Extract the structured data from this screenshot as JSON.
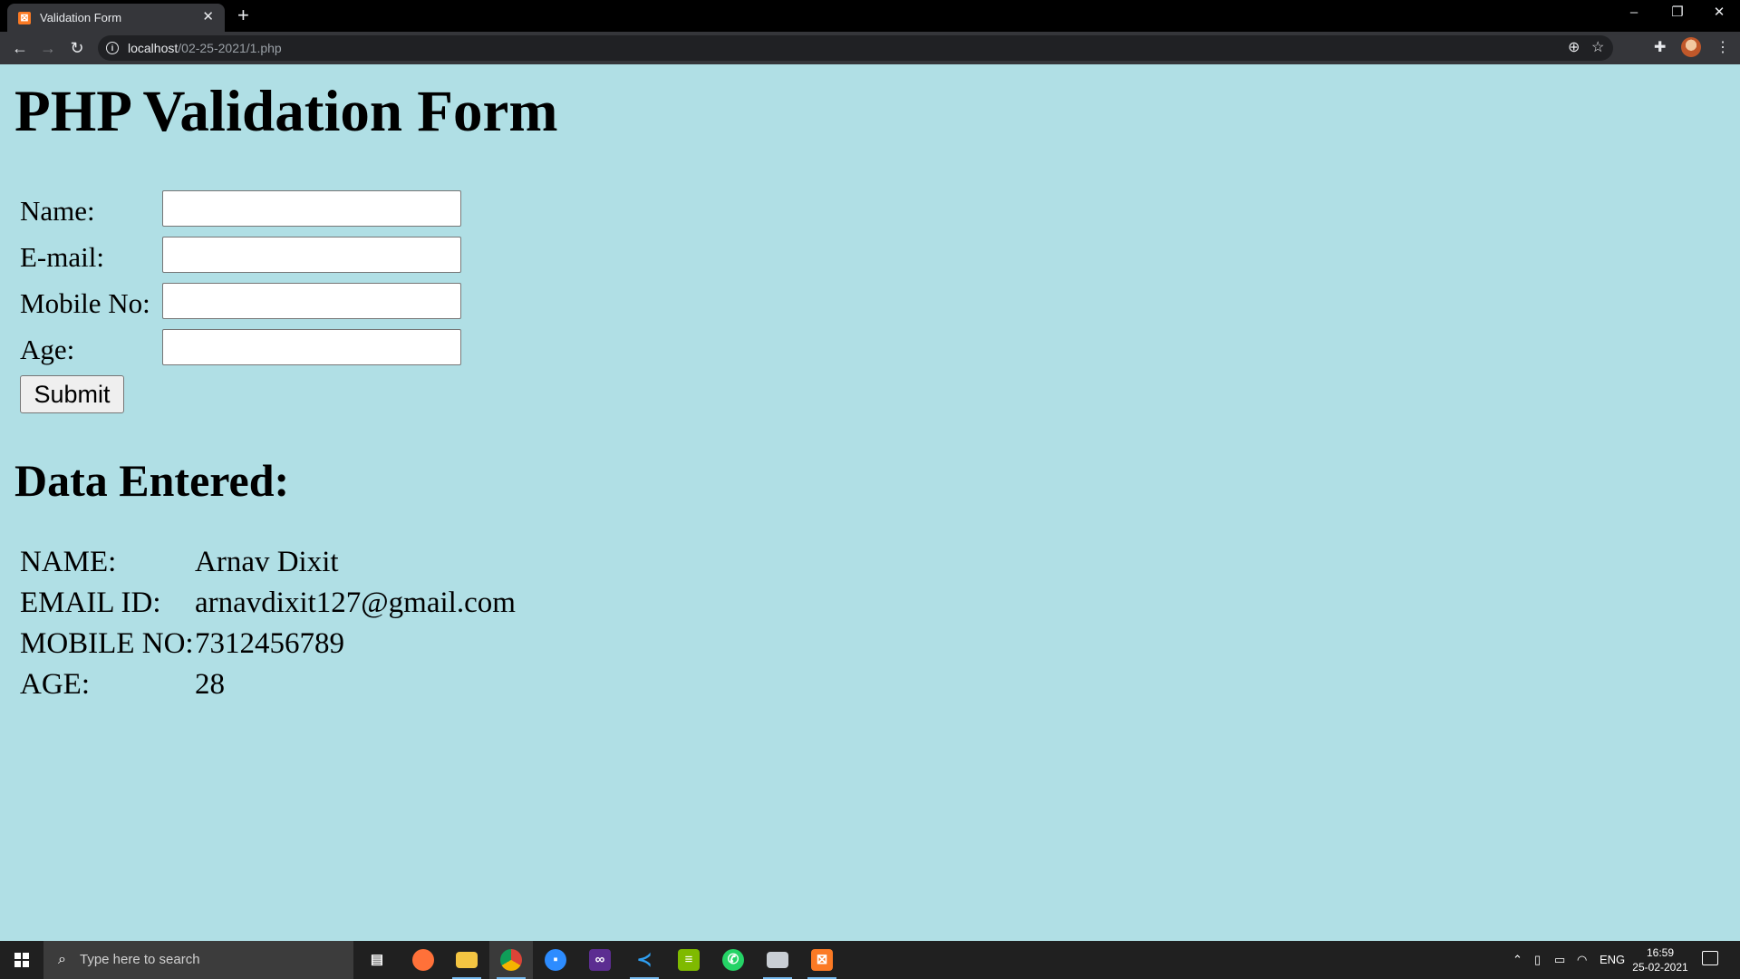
{
  "browser": {
    "tab_title": "Validation Form",
    "url_host": "localhost",
    "url_path": "/02-25-2021/1.php"
  },
  "page": {
    "title": "PHP Validation Form",
    "form": {
      "fields": [
        {
          "label": "Name:",
          "value": ""
        },
        {
          "label": "E-mail:",
          "value": ""
        },
        {
          "label": "Mobile No:",
          "value": ""
        },
        {
          "label": "Age:",
          "value": ""
        }
      ],
      "submit_label": "Submit"
    },
    "result": {
      "heading": "Data Entered:",
      "rows": [
        {
          "key": "NAME:",
          "value": "Arnav Dixit"
        },
        {
          "key": "EMAIL ID:",
          "value": "arnavdixit127@gmail.com"
        },
        {
          "key": "MOBILE NO:",
          "value": "7312456789"
        },
        {
          "key": "AGE:",
          "value": "28"
        }
      ]
    },
    "background_color": "#b0dfe5"
  },
  "taskbar": {
    "search_placeholder": "Type here to search",
    "apps": [
      "task-view",
      "firefox",
      "file-explorer",
      "chrome",
      "zoom",
      "visual-studio",
      "vscode",
      "notepad",
      "whatsapp",
      "mail",
      "xampp"
    ],
    "language": "ENG",
    "time": "16:59",
    "date": "25-02-2021"
  }
}
